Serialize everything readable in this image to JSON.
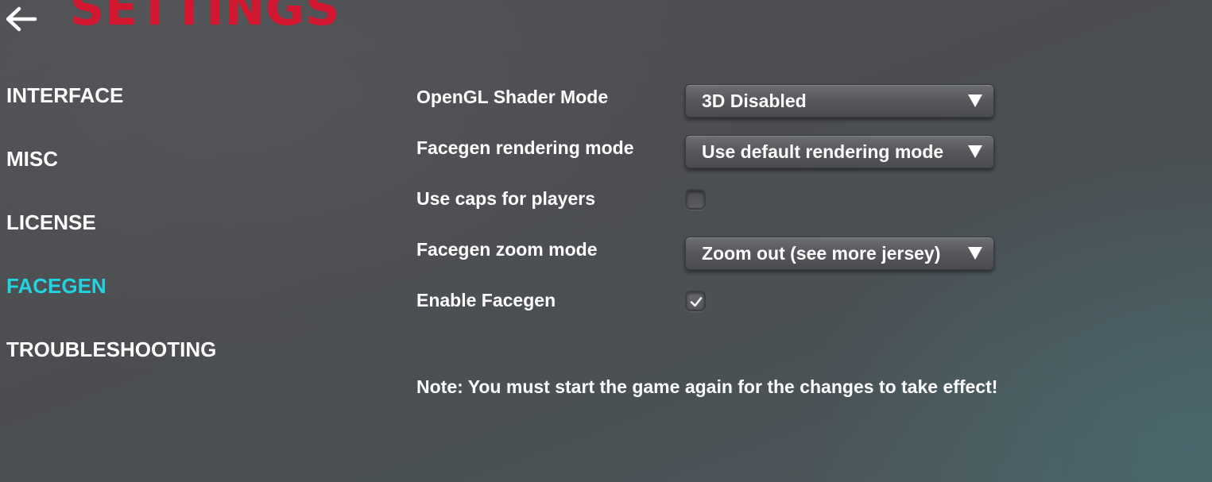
{
  "header": {
    "back_icon": "arrow-left-icon",
    "title": "SETTINGS",
    "title_color": "#d41730"
  },
  "sidebar": {
    "active_color": "#22d3e0",
    "items": [
      {
        "label": "INTERFACE",
        "active": false
      },
      {
        "label": "MISC",
        "active": false
      },
      {
        "label": "LICENSE",
        "active": false
      },
      {
        "label": "FACEGEN",
        "active": true
      },
      {
        "label": "TROUBLESHOOTING",
        "active": false
      }
    ]
  },
  "settings": {
    "opengl_shader_mode": {
      "label": "OpenGL Shader Mode",
      "value": "3D Disabled",
      "icon": "triangle-down-icon"
    },
    "facegen_rendering_mode": {
      "label": "Facegen rendering mode",
      "value": "Use default rendering mode",
      "icon": "triangle-down-icon"
    },
    "use_caps_for_players": {
      "label": "Use caps for players",
      "checked": false
    },
    "facegen_zoom_mode": {
      "label": "Facegen zoom mode",
      "value": "Zoom out (see more jersey)",
      "icon": "triangle-down-icon"
    },
    "enable_facegen": {
      "label": "Enable Facegen",
      "checked": true,
      "icon": "checkmark-icon"
    }
  },
  "note": "Note: You must start the game again for the changes to take effect!"
}
